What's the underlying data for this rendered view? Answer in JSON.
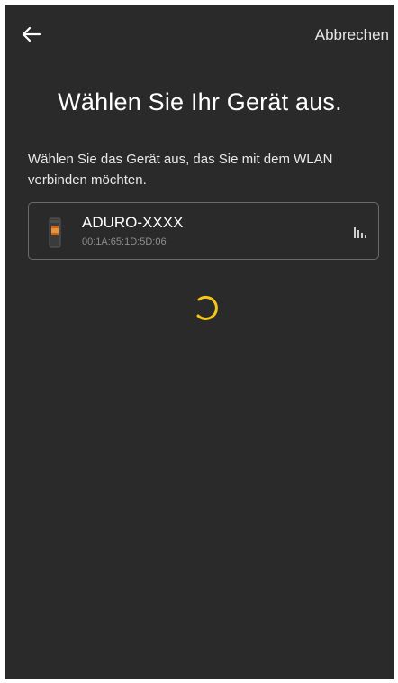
{
  "header": {
    "back_icon": "arrow-left-icon",
    "cancel_label": "Abbrechen"
  },
  "main": {
    "title": "Wählen Sie Ihr Gerät aus.",
    "subtitle": "Wählen Sie das Gerät aus, das Sie mit dem WLAN verbinden möchten."
  },
  "devices": [
    {
      "icon": "stove-icon",
      "name": "ADURO-XXXX",
      "mac": "00:1A:65:1D:5D:06",
      "signal_icon": "signal-strength-icon"
    }
  ],
  "loading": {
    "icon": "loading-spinner-icon"
  },
  "colors": {
    "background": "#2a2a2a",
    "text": "#ffffff",
    "secondary_text": "#8e8e8e",
    "card_border": "#6a6a6a",
    "accent": "#f5c518"
  }
}
